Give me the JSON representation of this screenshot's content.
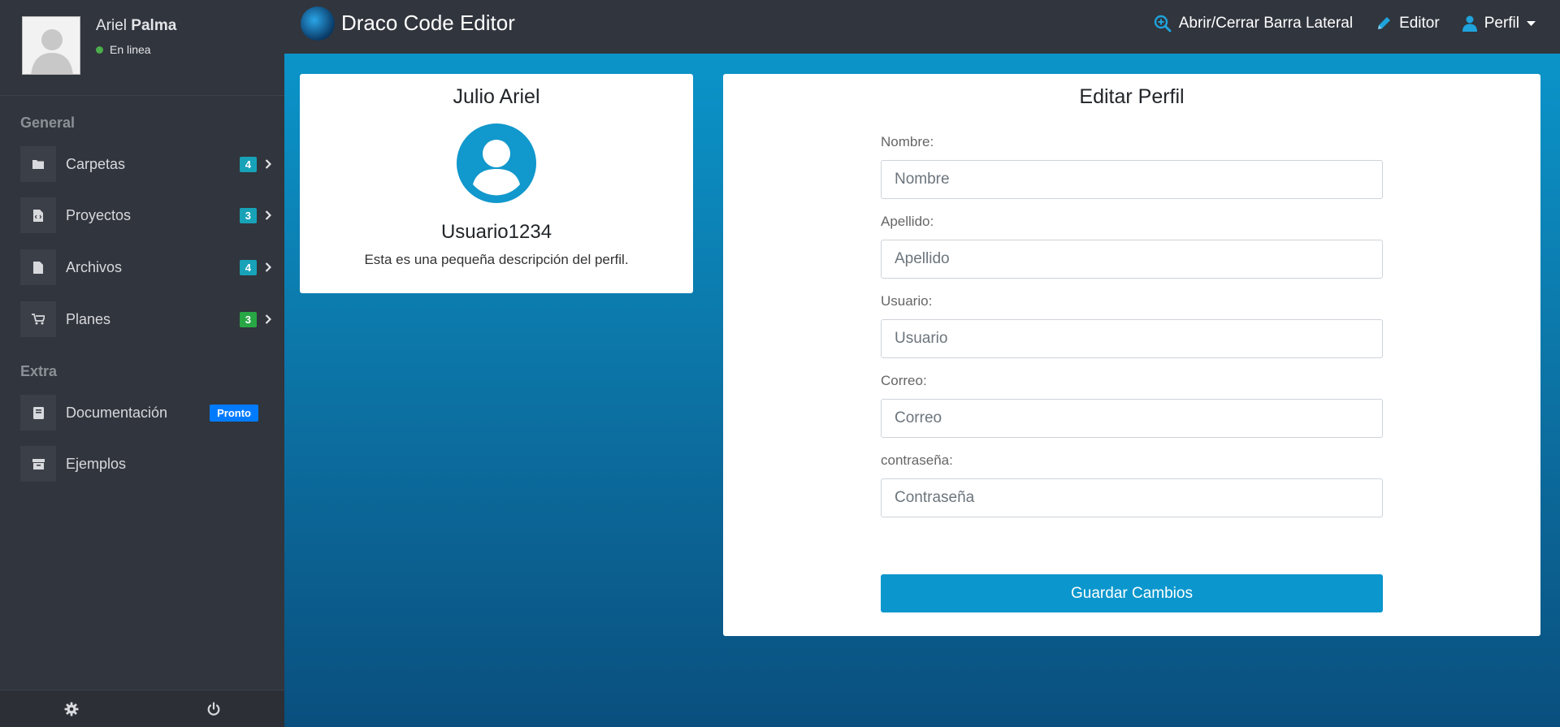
{
  "user": {
    "first_name": "Ariel",
    "last_name": "Palma",
    "status": "En linea"
  },
  "sidebar": {
    "section_general": "General",
    "section_extra": "Extra",
    "items": [
      {
        "label": "Carpetas",
        "badge": "4",
        "icon": "folder-icon"
      },
      {
        "label": "Proyectos",
        "badge": "3",
        "icon": "code-file-icon"
      },
      {
        "label": "Archivos",
        "badge": "4",
        "icon": "file-icon"
      },
      {
        "label": "Planes",
        "badge": "3",
        "icon": "cart-icon"
      },
      {
        "label": "Documentación",
        "badge": "Pronto",
        "icon": "book-icon"
      },
      {
        "label": "Ejemplos",
        "icon": "archive-icon"
      }
    ],
    "footer": {
      "settings_icon": "gear-icon",
      "power_icon": "power-icon"
    }
  },
  "topbar": {
    "brand": "Draco Code Editor",
    "toggle_sidebar": "Abrir/Cerrar Barra Lateral",
    "editor": "Editor",
    "profile": "Perfil"
  },
  "profile_card": {
    "name": "Julio Ariel",
    "username": "Usuario1234",
    "description": "Esta es una pequeña descripción del perfil."
  },
  "edit_form": {
    "title": "Editar Perfil",
    "fields": [
      {
        "label": "Nombre:",
        "placeholder": "Nombre",
        "value": ""
      },
      {
        "label": "Apellido:",
        "placeholder": "Apellido",
        "value": ""
      },
      {
        "label": "Usuario:",
        "placeholder": "Usuario",
        "value": ""
      },
      {
        "label": "Correo:",
        "placeholder": "Correo",
        "value": ""
      },
      {
        "label": "contraseña:",
        "placeholder": "Contraseña",
        "value": ""
      }
    ],
    "submit": "Guardar Cambios"
  },
  "colors": {
    "sidebar_bg": "#31353d",
    "accent": "#0b97cd",
    "badge_teal": "#17a2b8",
    "badge_green": "#28a745",
    "badge_blue": "#007bff",
    "status_online": "#4cae4c"
  }
}
